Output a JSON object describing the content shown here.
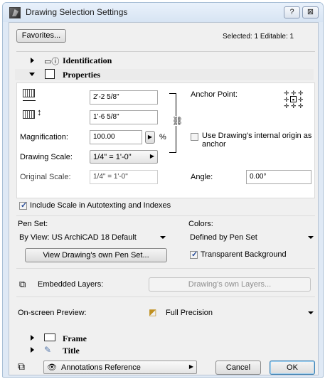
{
  "window": {
    "title": "Drawing Selection Settings",
    "help_label": "?",
    "close_label": "⊠"
  },
  "top": {
    "favorites_label": "Favorites...",
    "selected_status": "Selected: 1 Editable: 1"
  },
  "sections": {
    "identification": "Identification",
    "properties": "Properties",
    "frame": "Frame",
    "title": "Title"
  },
  "properties": {
    "width_value": "2'-2 5/8\"",
    "height_value": "1'-6 5/8\"",
    "magnification_label": "Magnification:",
    "magnification_value": "100.00",
    "percent": "%",
    "drawing_scale_label": "Drawing Scale:",
    "drawing_scale_value": "1/4\"  =  1'-0\"",
    "original_scale_label": "Original Scale:",
    "original_scale_value": "1/4\"  =  1'-0\"",
    "anchor_point_label": "Anchor Point:",
    "use_origin_label": "Use Drawing's internal origin as anchor",
    "angle_label": "Angle:",
    "angle_value": "0.00°",
    "include_scale_label": "Include Scale in Autotexting and Indexes",
    "include_scale_checked": true,
    "use_origin_checked": false,
    "pen_set_label": "Pen Set:",
    "pen_set_value": "By View: US ArchiCAD 18 Default",
    "colors_label": "Colors:",
    "colors_value": "Defined by Pen Set",
    "view_pen_set_label": "View Drawing's own Pen Set...",
    "transparent_bg_label": "Transparent Background",
    "transparent_bg_checked": true,
    "embedded_layers_label": "Embedded Layers:",
    "own_layers_label": "Drawing's own Layers...",
    "preview_label": "On-screen Preview:",
    "preview_value": "Full Precision"
  },
  "bottom": {
    "annotations_label": "Annotations Reference",
    "cancel_label": "Cancel",
    "ok_label": "OK"
  }
}
